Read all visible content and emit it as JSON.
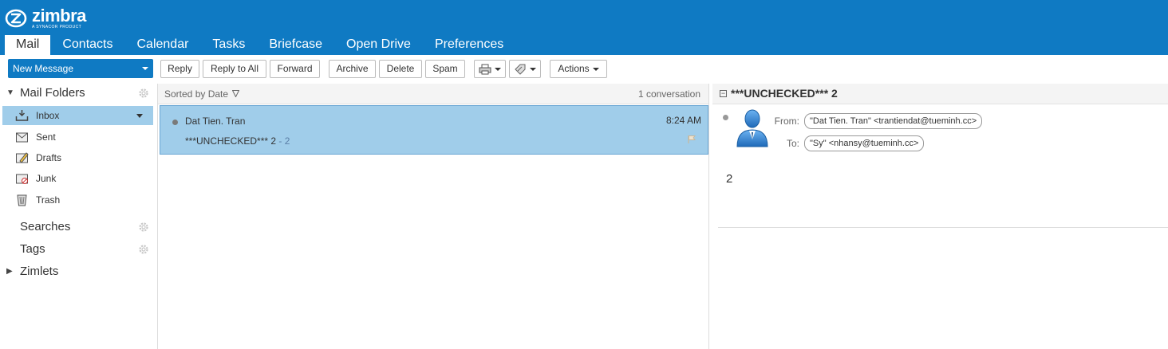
{
  "brand": {
    "name": "zimbra",
    "tagline": "A SYNACOR PRODUCT"
  },
  "app_tabs": [
    "Mail",
    "Contacts",
    "Calendar",
    "Tasks",
    "Briefcase",
    "Open Drive",
    "Preferences"
  ],
  "toolbar": {
    "new_message": "New Message",
    "reply": "Reply",
    "reply_all": "Reply to All",
    "forward": "Forward",
    "archive": "Archive",
    "delete": "Delete",
    "spam": "Spam",
    "actions": "Actions"
  },
  "sidebar": {
    "mail_folders": "Mail Folders",
    "folders": [
      {
        "label": "Inbox",
        "icon": "inbox-icon"
      },
      {
        "label": "Sent",
        "icon": "sent-icon"
      },
      {
        "label": "Drafts",
        "icon": "drafts-icon"
      },
      {
        "label": "Junk",
        "icon": "junk-icon"
      },
      {
        "label": "Trash",
        "icon": "trash-icon"
      }
    ],
    "searches": "Searches",
    "tags": "Tags",
    "zimlets": "Zimlets"
  },
  "list": {
    "sort_label": "Sorted by Date",
    "count": "1 conversation",
    "messages": [
      {
        "from": "Dat Tien. Tran",
        "time": "8:24 AM",
        "subject": "***UNCHECKED*** 2",
        "fragment": " - 2"
      }
    ]
  },
  "reader": {
    "title": "***UNCHECKED*** 2",
    "from_label": "From:",
    "from_value": "\"Dat Tien. Tran\" <trantiendat@tueminh.cc>",
    "to_label": "To:",
    "to_value": "\"Sy\" <nhansy@tueminh.cc>",
    "body": "2"
  },
  "colors": {
    "brand_blue": "#0f7ac3",
    "selection": "#a0cdea"
  }
}
